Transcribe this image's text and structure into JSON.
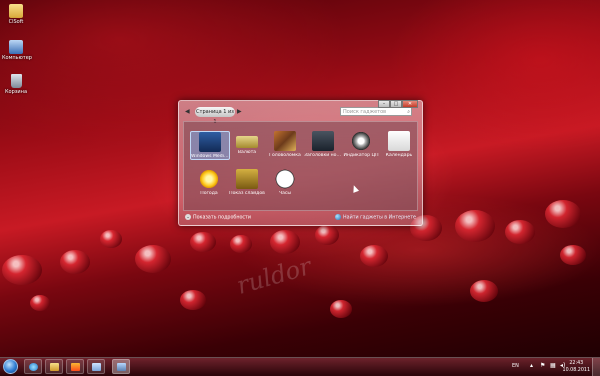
{
  "desktop": {
    "icons": [
      {
        "label": "ClSoft",
        "icon": "folder-icon"
      },
      {
        "label": "Компьютер",
        "icon": "computer-icon"
      },
      {
        "label": "Корзина",
        "icon": "recycle-bin-icon"
      }
    ],
    "watermark": "ruldor"
  },
  "gadget_window": {
    "page_indicator": "Страница 1 из 1",
    "search_placeholder": "Поиск гаджетов",
    "gadgets": [
      {
        "label": "Windows Media...",
        "icon": "windows-media-center-icon",
        "selected": true
      },
      {
        "label": "Валюта",
        "icon": "currency-icon"
      },
      {
        "label": "Головоломка",
        "icon": "puzzle-icon"
      },
      {
        "label": "Заголовки новостей...",
        "icon": "feed-headlines-icon"
      },
      {
        "label": "Индикатор ЦП",
        "icon": "cpu-meter-icon"
      },
      {
        "label": "Календарь",
        "icon": "calendar-icon"
      },
      {
        "label": "Погода",
        "icon": "weather-icon"
      },
      {
        "label": "Показ слайдов",
        "icon": "slideshow-icon"
      },
      {
        "label": "Часы",
        "icon": "clock-icon"
      }
    ],
    "details_label": "Показать подробности",
    "online_label": "Найти гаджеты в Интернете"
  },
  "taskbar": {
    "pinned": [
      {
        "name": "internet-explorer-button"
      },
      {
        "name": "windows-explorer-button"
      },
      {
        "name": "media-player-button"
      },
      {
        "name": "window-button"
      },
      {
        "name": "gadgets-button",
        "active": true
      }
    ],
    "language": "EN",
    "time": "22:43",
    "date": "10.08.2011"
  }
}
